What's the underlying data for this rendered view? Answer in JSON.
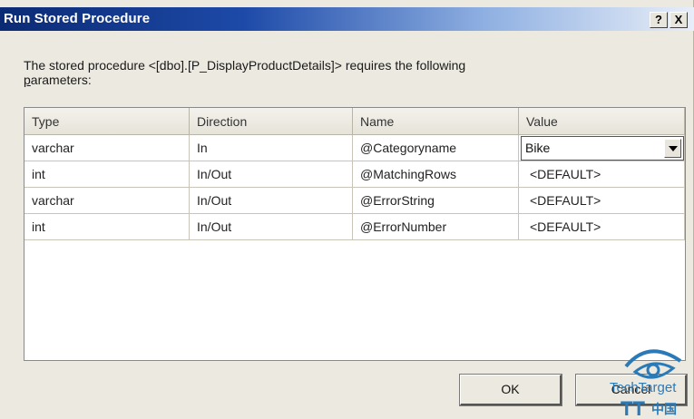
{
  "window": {
    "title": "Run Stored Procedure",
    "help_label": "?",
    "close_label": "X"
  },
  "message": {
    "line1": "The stored procedure <[dbo].[P_DisplayProductDetails]> requires the following",
    "line2_first": "p",
    "line2_rest": "arameters:"
  },
  "grid": {
    "columns": [
      "Type",
      "Direction",
      "Name",
      "Value"
    ],
    "rows": [
      {
        "type": "varchar",
        "direction": "In",
        "name": "@Categoryname",
        "value": "Bike"
      },
      {
        "type": "int",
        "direction": "In/Out",
        "name": "@MatchingRows",
        "value": "<DEFAULT>"
      },
      {
        "type": "varchar",
        "direction": "In/Out",
        "name": "@ErrorString",
        "value": "<DEFAULT>"
      },
      {
        "type": "int",
        "direction": "In/Out",
        "name": "@ErrorNumber",
        "value": "<DEFAULT>"
      }
    ]
  },
  "buttons": {
    "ok": "OK",
    "cancel": "Cancel"
  },
  "watermark": {
    "text_top": "TechTarget",
    "text_bottom": "TT",
    "text_cjk": "中国",
    "color": "#2a7ab8"
  }
}
